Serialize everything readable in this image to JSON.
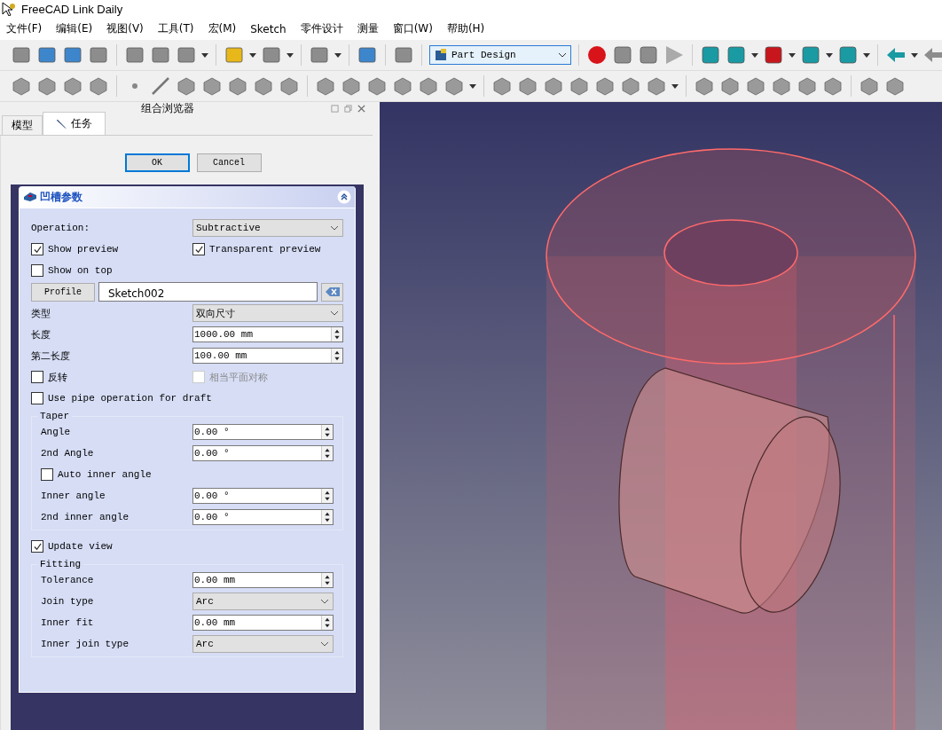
{
  "window": {
    "title": "FreeCAD Link Daily"
  },
  "menu": [
    "文件(F)",
    "编辑(E)",
    "视图(V)",
    "工具(T)",
    "宏(M)",
    "Sketch",
    "零件设计",
    "测量",
    "窗口(W)",
    "帮助(H)"
  ],
  "workbench": {
    "value": "Part Design"
  },
  "combo_view": {
    "title": "组合浏览器",
    "tabs": [
      {
        "label": "模型",
        "selected": false
      },
      {
        "label": "任务",
        "selected": true
      }
    ]
  },
  "buttons": [
    {
      "label": "OK",
      "selected": true
    },
    {
      "label": "Cancel",
      "selected": false
    }
  ],
  "task_panel": {
    "title": "凹槽参数",
    "rows": [
      {
        "kind": "dropdown",
        "label": "Operation:",
        "value": "Subtractive"
      },
      {
        "kind": "checks",
        "items": [
          {
            "label": "Show preview",
            "checked": true,
            "disabled": false
          },
          {
            "label": "Transparent preview",
            "checked": true,
            "disabled": false
          }
        ]
      },
      {
        "kind": "checks",
        "items": [
          {
            "label": "Show on top",
            "checked": false,
            "disabled": false
          }
        ]
      },
      {
        "kind": "profile",
        "label": "Profile",
        "value": "Sketch002"
      },
      {
        "kind": "dropdown",
        "label": "类型",
        "value": "双向尺寸"
      },
      {
        "kind": "spin",
        "label": "长度",
        "value": "1000.00 mm"
      },
      {
        "kind": "spin",
        "label": "第二长度",
        "value": "100.00 mm"
      },
      {
        "kind": "checks",
        "items": [
          {
            "label": "反转",
            "checked": false,
            "disabled": false
          },
          {
            "label": "相当平面对称",
            "checked": false,
            "disabled": true
          }
        ]
      },
      {
        "kind": "checks",
        "items": [
          {
            "label": "Use pipe operation for draft",
            "checked": false,
            "disabled": false
          }
        ]
      },
      {
        "kind": "group",
        "title": "Taper",
        "rows": [
          {
            "kind": "spin",
            "label": "Angle",
            "value": "0.00 °"
          },
          {
            "kind": "spin",
            "label": "2nd Angle",
            "value": "0.00 °"
          },
          {
            "kind": "checks",
            "items": [
              {
                "label": "Auto inner angle",
                "checked": false,
                "disabled": false
              }
            ]
          },
          {
            "kind": "spin",
            "label": "Inner angle",
            "value": "0.00 °"
          },
          {
            "kind": "spin",
            "label": "2nd inner angle",
            "value": "0.00 °"
          }
        ]
      },
      {
        "kind": "checks",
        "items": [
          {
            "label": "Update view",
            "checked": true,
            "disabled": false
          }
        ]
      },
      {
        "kind": "group",
        "title": "Fitting",
        "rows": [
          {
            "kind": "spin",
            "label": "Tolerance",
            "value": "0.00 mm"
          },
          {
            "kind": "dropdown",
            "label": "Join type",
            "value": "Arc"
          },
          {
            "kind": "spin",
            "label": "Inner fit",
            "value": "0.00 mm"
          },
          {
            "kind": "dropdown",
            "label": "Inner join type",
            "value": "Arc"
          }
        ]
      }
    ]
  }
}
